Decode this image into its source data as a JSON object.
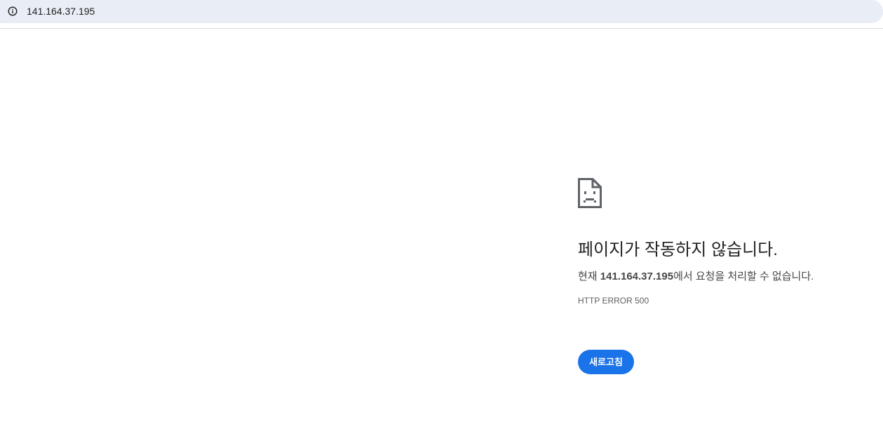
{
  "address_bar": {
    "icon": "info-icon",
    "url": "141.164.37.195"
  },
  "error_page": {
    "icon": "sad-page-icon",
    "headline": "페이지가 작동하지 않습니다.",
    "description_prefix": "현재 ",
    "host": "141.164.37.195",
    "description_suffix": "에서 요청을 처리할 수 없습니다.",
    "error_code": "HTTP ERROR 500",
    "reload_label": "새로고침"
  },
  "colors": {
    "accent": "#1a73e8",
    "omnibox_bg": "#e9eef6",
    "text_primary": "#1f1f1f",
    "text_secondary": "#474747"
  }
}
